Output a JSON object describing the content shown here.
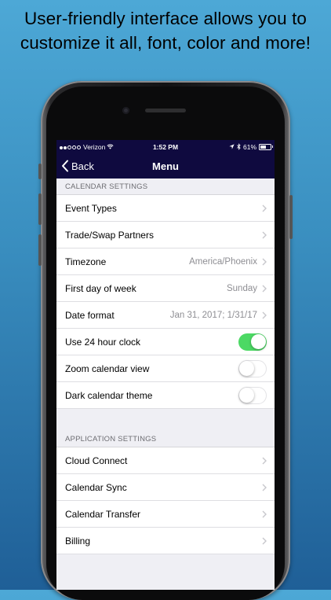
{
  "headline": {
    "line1": "User-friendly interface allows you to",
    "line2": "customize it all, font, color and more!"
  },
  "status_bar": {
    "carrier": "Verizon",
    "time": "1:52 PM",
    "battery": "61%",
    "battery_level": 0.61
  },
  "nav": {
    "back_label": "Back",
    "title": "Menu"
  },
  "calendar_settings": {
    "header": "CALENDAR SETTINGS",
    "rows": [
      {
        "label": "Event Types",
        "value": ""
      },
      {
        "label": "Trade/Swap Partners",
        "value": ""
      },
      {
        "label": "Timezone",
        "value": "America/Phoenix"
      },
      {
        "label": "First day of week",
        "value": "Sunday"
      },
      {
        "label": "Date format",
        "value": "Jan 31, 2017; 1/31/17"
      }
    ],
    "toggles": [
      {
        "label": "Use 24 hour clock",
        "on": true
      },
      {
        "label": "Zoom calendar view",
        "on": false
      },
      {
        "label": "Dark calendar theme",
        "on": false
      }
    ]
  },
  "application_settings": {
    "header": "APPLICATION SETTINGS",
    "rows": [
      {
        "label": "Cloud Connect"
      },
      {
        "label": "Calendar Sync"
      },
      {
        "label": "Calendar Transfer"
      },
      {
        "label": "Billing"
      }
    ]
  },
  "colors": {
    "nav_bg": "#0f0a3f",
    "toggle_on": "#4cd964",
    "background_top": "#4da8d6",
    "background_bottom": "#1f5f97"
  },
  "icons": {
    "back": "chevron-left-icon",
    "row_disclosure": "chevron-right-icon",
    "wifi": "wifi-icon",
    "location": "location-arrow-icon",
    "bluetooth": "bluetooth-icon",
    "battery": "battery-icon"
  }
}
